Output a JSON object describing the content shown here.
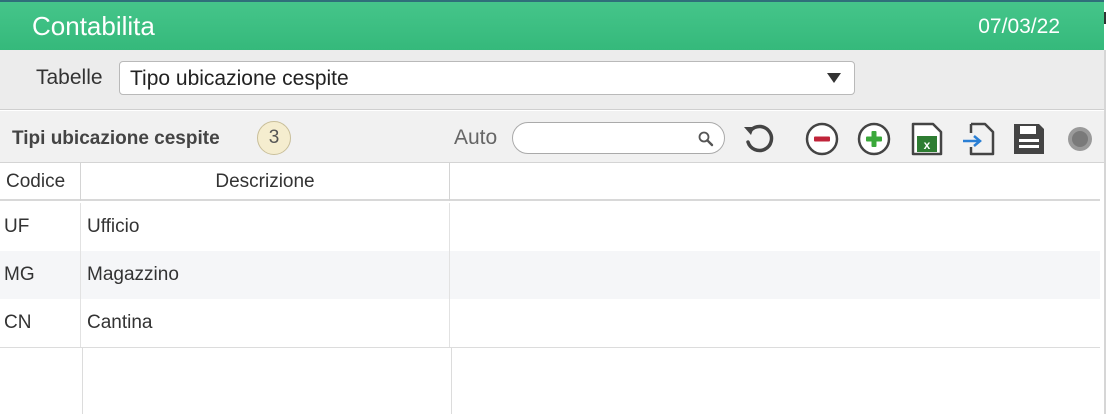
{
  "header": {
    "title": "Contabilita",
    "date": "07/03/22"
  },
  "table_selector": {
    "label": "Tabelle",
    "selected": "Tipo ubicazione cespite"
  },
  "toolbar": {
    "heading": "Tipi ubicazione cespite",
    "count": "3",
    "auto_label": "Auto",
    "search_value": "",
    "icons": [
      "search-icon",
      "refresh-icon",
      "remove-icon",
      "add-icon",
      "excel-export-icon",
      "import-icon",
      "save-icon",
      "status-indicator-icon"
    ]
  },
  "grid": {
    "columns": [
      "Codice",
      "Descrizione"
    ],
    "rows": [
      {
        "code": "UF",
        "description": "Ufficio"
      },
      {
        "code": "MG",
        "description": "Magazzino"
      },
      {
        "code": "CN",
        "description": "Cantina"
      }
    ]
  },
  "colors": {
    "header_green": "#3dbf82",
    "remove_red": "#c0243a",
    "add_green": "#3aa83a",
    "excel_green": "#2e7d32",
    "import_blue": "#2a7fd4"
  }
}
